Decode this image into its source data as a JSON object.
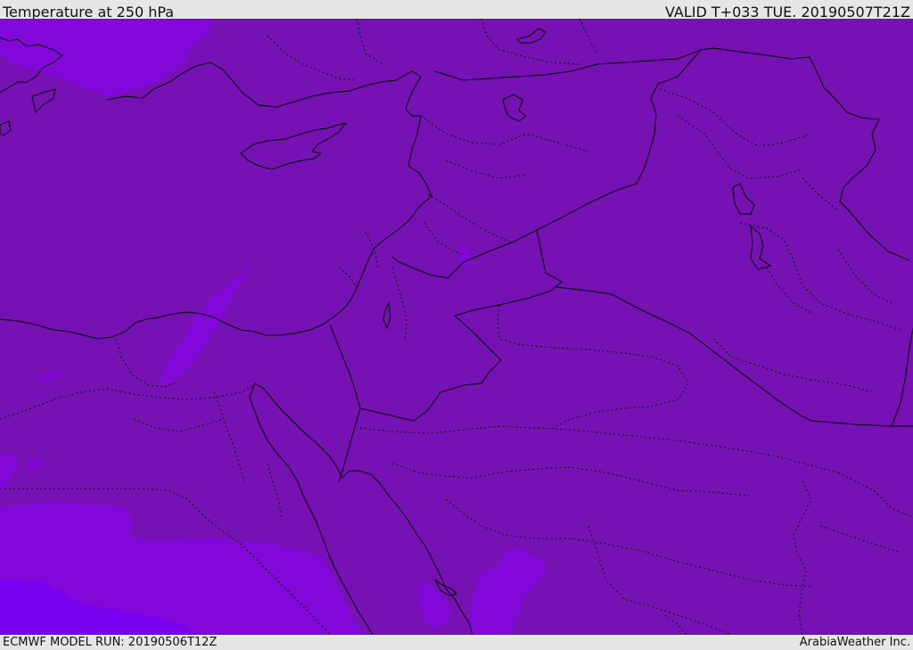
{
  "header": {
    "title": "Temperature at 250 hPa",
    "valid": "VALID T+033 TUE. 20190507T21Z"
  },
  "footer": {
    "model_run": "ECMWF MODEL RUN: 20190506T12Z",
    "credit": "ArabiaWeather Inc."
  },
  "colors": {
    "field_main": "#7612b3",
    "field_warm": "#8208da",
    "field_warmer": "#7a00f0",
    "coastline": "#000000",
    "frame_background": "#e6e6e6"
  }
}
